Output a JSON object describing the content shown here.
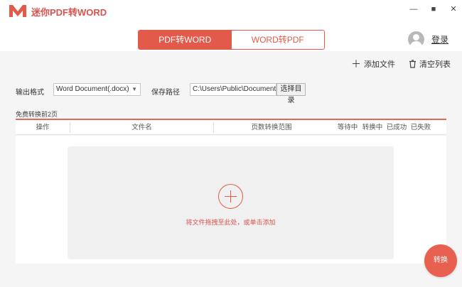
{
  "app": {
    "title": "迷你PDF转WORD",
    "accent_color": "#e25a4a"
  },
  "window_controls": {
    "minimize": "—",
    "maximize": "■",
    "close": "✕"
  },
  "tabs": [
    {
      "label": "PDF转WORD",
      "active": true
    },
    {
      "label": "WORD转PDF",
      "active": false
    }
  ],
  "user": {
    "login_label": "登录",
    "avatar_icon": "user-avatar-icon"
  },
  "toolbar": {
    "add_file_label": "添加文件",
    "add_file_icon": "plus-icon",
    "clear_list_label": "清空列表",
    "clear_list_icon": "trash-icon"
  },
  "settings": {
    "output_format_label": "输出格式",
    "output_format_value": "Word Document(.docx)",
    "save_path_label": "保存路径",
    "save_path_value": "C:\\Users\\Public\\Documents",
    "choose_dir_label": "选择目录"
  },
  "free_note": "免费转换前2页",
  "table": {
    "columns": [
      "操作",
      "文件名",
      "页数转换范围",
      "等待中",
      "转换中",
      "已成功",
      "已失败"
    ]
  },
  "dropzone": {
    "text": "将文件拖拽至此处，或单击添加",
    "icon": "add-circle-icon"
  },
  "convert_button": "转换"
}
